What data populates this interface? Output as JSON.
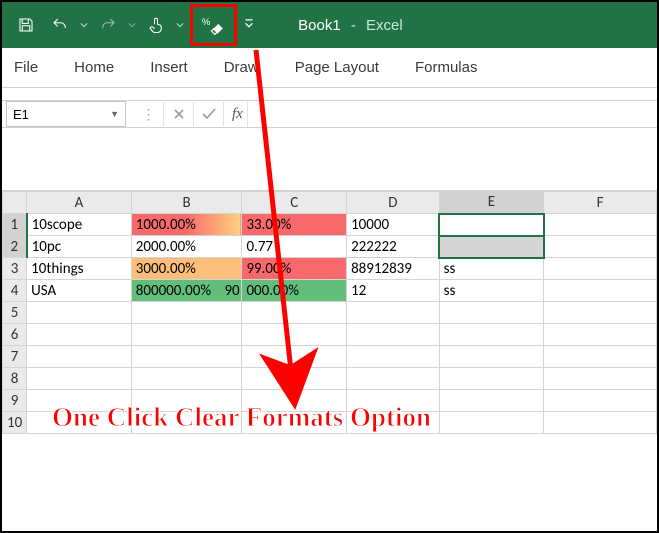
{
  "app": {
    "book": "Book1",
    "dash": "-",
    "name": "Excel"
  },
  "qat": {
    "save": "save-icon",
    "undo": "undo-icon",
    "redo": "redo-icon",
    "touch": "touch-icon",
    "clear": "clear-formats-icon",
    "more": "more-icon"
  },
  "tabs": [
    "File",
    "Home",
    "Insert",
    "Draw",
    "Page Layout",
    "Formulas"
  ],
  "namebox": "E1",
  "fx": "fx",
  "columns": [
    "A",
    "B",
    "C",
    "D",
    "E",
    "F"
  ],
  "rows": [
    "1",
    "2",
    "3",
    "4",
    "5",
    "6",
    "7",
    "8",
    "9",
    "10"
  ],
  "cells": {
    "A1": "10scope",
    "B1": "1000.00%",
    "C1": "33.00%",
    "D1": "10000",
    "A2": "10pc",
    "B2": "2000.00%",
    "C2": "0.77",
    "D2": "222222",
    "A3": "10things",
    "B3": "3000.00%",
    "C3": "99.00%",
    "D3": "88912839",
    "E3": "ss",
    "A4": "USA",
    "B4": "800000.00%",
    "C4_pre": "90",
    "C4": "000.00%",
    "D4": "12",
    "E4": "ss"
  },
  "chart_data": {
    "type": "table",
    "note": "Spreadsheet cells with conditional formatting color scale applied to columns B and C",
    "rows": [
      {
        "A": "10scope",
        "B": "1000.00%",
        "C": "33.00%",
        "D": 10000,
        "E": ""
      },
      {
        "A": "10pc",
        "B": "2000.00%",
        "C": 0.77,
        "D": 222222,
        "E": ""
      },
      {
        "A": "10things",
        "B": "3000.00%",
        "C": "99.00%",
        "D": 88912839,
        "E": "ss"
      },
      {
        "A": "USA",
        "B": "800000.00%",
        "C": "90000.00%",
        "D": 12,
        "E": "ss"
      }
    ]
  },
  "caption": "One Click Clear Formats Option"
}
